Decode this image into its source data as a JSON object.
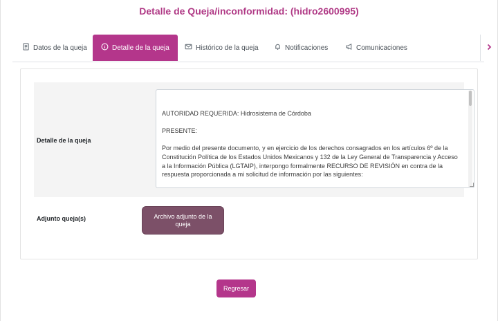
{
  "header": {
    "title": "Detalle de Queja/inconformidad: (hidro2600995)"
  },
  "tabs": [
    {
      "label": "Datos de la queja",
      "icon": "document-icon",
      "active": false
    },
    {
      "label": "Detalle de la queja",
      "icon": "info-circle-icon",
      "active": true
    },
    {
      "label": "Histórico de la queja",
      "icon": "envelope-icon",
      "active": false
    },
    {
      "label": "Notificaciones",
      "icon": "bell-icon",
      "active": false
    },
    {
      "label": "Comunicaciones",
      "icon": "megaphone-icon",
      "active": false
    }
  ],
  "tabs_next_icon": "chevron-right-icon",
  "detail": {
    "label": "Detalle de la queja",
    "text": "AUTORIDAD REQUERIDA: Hidrosistema de Córdoba\n\nPRESENTE:\n\nPor medio del presente documento, y en ejercicio de los derechos consagrados en los artículos 6º de la Constitución Política de los Estados Unidos Mexicanos y 132 de la Ley General de Transparencia y Acceso a la Información Pública (LGTAIP), interpongo formalmente RECURSO DE REVISIÓN en contra de la respuesta proporcionada a mi solicitud de información por las siguientes:"
  },
  "attachment": {
    "label": "Adjunto queja(s)",
    "button_label": "Archivo adjunto de la queja"
  },
  "footer": {
    "back_label": "Regresar"
  },
  "colors": {
    "brand": "#b4368b",
    "title": "#b03a86",
    "attachment_button": "#7c5068"
  }
}
